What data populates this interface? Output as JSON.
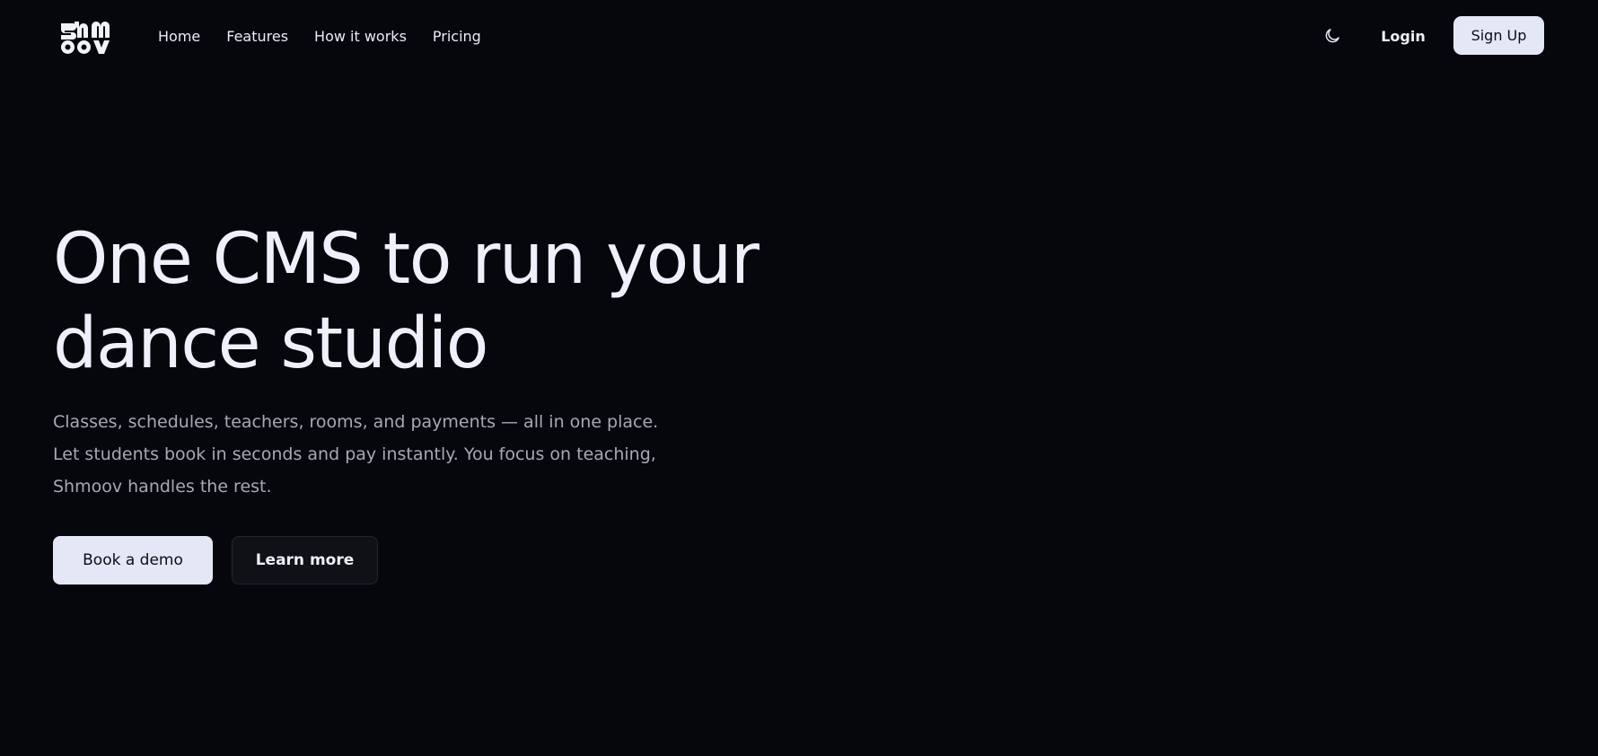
{
  "nav": {
    "logo_icon": "shmoov-logo-icon",
    "links": [
      {
        "label": "Home"
      },
      {
        "label": "Features"
      },
      {
        "label": "How it works"
      },
      {
        "label": "Pricing"
      }
    ],
    "theme_icon": "moon-icon",
    "login_label": "Login",
    "signup_label": "Sign Up"
  },
  "hero": {
    "title_line1": "One CMS to run your",
    "title_line2": "dance studio",
    "description": "Classes, schedules, teachers, rooms, and payments — all in one place. Let students book in seconds and pay instantly. You focus on teaching, Shmoov handles the rest.",
    "primary_label": "Book a demo",
    "secondary_label": "Learn more"
  },
  "colors": {
    "background": "#06070c",
    "button_light": "#e4e7f5",
    "button_dark": "#101117",
    "text_primary": "#eef1fb",
    "text_muted": "#a6a9b6"
  }
}
